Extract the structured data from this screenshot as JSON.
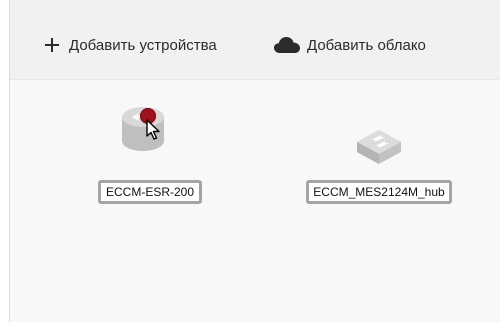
{
  "toolbar": {
    "add_devices_label": "Добавить устройства",
    "add_cloud_label": "Добавить облако"
  },
  "nodes": [
    {
      "name": "ECCM-ESR-200",
      "type": "router",
      "icon": "router-icon",
      "status_color": "#a0121b"
    },
    {
      "name": "ECCM_MES2124M_hub",
      "type": "switch",
      "icon": "switch-icon"
    }
  ],
  "colors": {
    "toolbar_bg": "#f1f1f1",
    "canvas_bg": "#f8f8f8",
    "device_gray": "#c8c8c8",
    "status_red": "#a0121b"
  }
}
